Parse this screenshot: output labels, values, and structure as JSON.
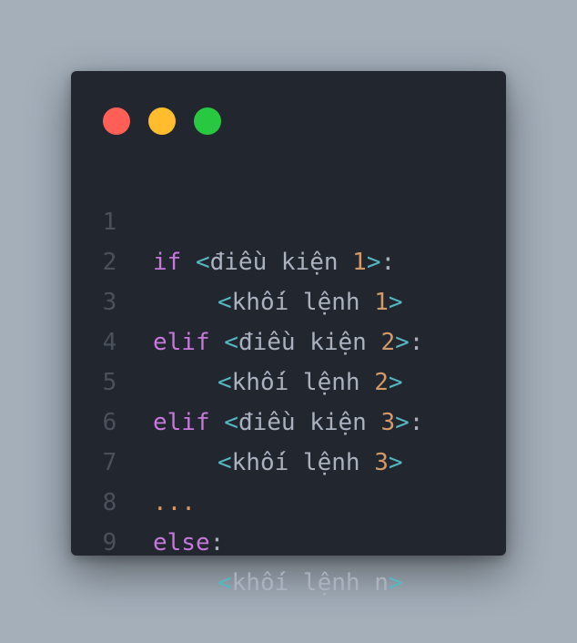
{
  "window": {
    "traffic_lights": [
      {
        "name": "close",
        "color": "#ff5f57"
      },
      {
        "name": "minimize",
        "color": "#ffbd2e"
      },
      {
        "name": "maximize",
        "color": "#28c840"
      }
    ]
  },
  "colors": {
    "background": "#a4afba",
    "editor_bg": "#22262e",
    "keyword": "#c678dd",
    "punct": "#56b6c2",
    "number": "#d19a66",
    "text": "#abb2bf",
    "line_number": "#4b515c"
  },
  "code": {
    "lines": [
      {
        "num": "1",
        "kw": "if",
        "open": "<",
        "text": "điều kiện ",
        "val": "1",
        "close": ">",
        "colon": ":"
      },
      {
        "num": "2",
        "open": "<",
        "text": "khối lệnh ",
        "val": "1",
        "close": ">"
      },
      {
        "num": "3",
        "kw": "elif",
        "open": "<",
        "text": "điều kiện ",
        "val": "2",
        "close": ">",
        "colon": ":"
      },
      {
        "num": "4",
        "open": "<",
        "text": "khối lệnh ",
        "val": "2",
        "close": ">"
      },
      {
        "num": "5",
        "kw": "elif",
        "open": "<",
        "text": "điều kiện ",
        "val": "3",
        "close": ">",
        "colon": ":"
      },
      {
        "num": "6",
        "open": "<",
        "text": "khối lệnh ",
        "val": "3",
        "close": ">"
      },
      {
        "num": "7",
        "ellipsis": "..."
      },
      {
        "num": "8",
        "kw": "else",
        "colon": ":"
      },
      {
        "num": "9",
        "open": "<",
        "text": "khối lệnh n",
        "close": ">"
      }
    ]
  }
}
